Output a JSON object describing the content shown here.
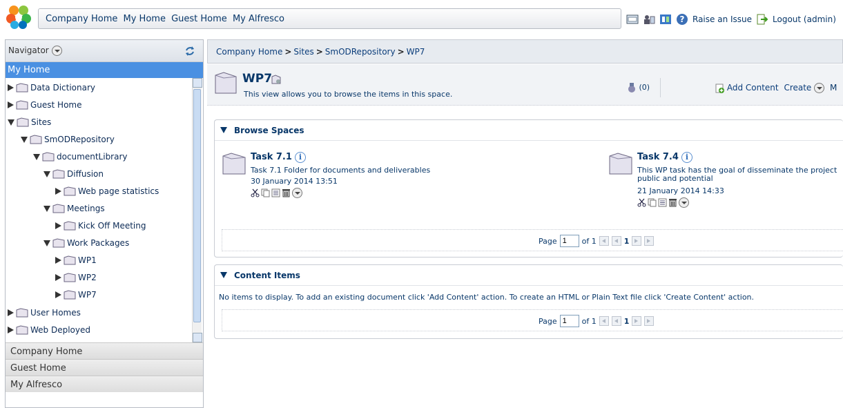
{
  "topnav": {
    "links": [
      "Company Home",
      "My Home",
      "Guest Home",
      "My Alfresco"
    ],
    "raise_issue": "Raise an Issue",
    "logout": "Logout (admin)"
  },
  "sidebar": {
    "navigator_label": "Navigator",
    "selected_section": "My Home",
    "tree": [
      {
        "label": "Data Dictionary",
        "expanded": false
      },
      {
        "label": "Guest Home",
        "expanded": false
      },
      {
        "label": "Sites",
        "expanded": true
      },
      {
        "label": "SmODRepository",
        "expanded": true
      },
      {
        "label": "documentLibrary",
        "expanded": true
      },
      {
        "label": "Diffusion",
        "expanded": true
      },
      {
        "label": "Web page statistics",
        "expanded": false
      },
      {
        "label": "Meetings",
        "expanded": true
      },
      {
        "label": "Kick Off Meeting",
        "expanded": false
      },
      {
        "label": "Work Packages",
        "expanded": true
      },
      {
        "label": "WP1",
        "expanded": false
      },
      {
        "label": "WP2",
        "expanded": false
      },
      {
        "label": "WP7",
        "expanded": false
      },
      {
        "label": "User Homes",
        "expanded": false
      },
      {
        "label": "Web Deployed",
        "expanded": false
      }
    ],
    "accordion": [
      "Company Home",
      "Guest Home",
      "My Alfresco"
    ]
  },
  "breadcrumb": [
    "Company Home",
    "Sites",
    "SmODRepository",
    "WP7"
  ],
  "space": {
    "title": "WP7",
    "description": "This view allows you to browse the items in this space.",
    "rss_count": "(0)",
    "add_content": "Add Content",
    "create": "Create",
    "more": "M"
  },
  "browse_spaces": {
    "title": "Browse Spaces",
    "items": [
      {
        "title": "Task 7.1",
        "desc": "Task 7.1 Folder for documents and deliverables",
        "desc2": "",
        "date": "30 January 2014 13:51"
      },
      {
        "title": "Task 7.4",
        "desc": "This WP task has the goal of disseminate the project",
        "desc2": "public and potential",
        "date": "21 January 2014 14:33"
      }
    ],
    "pager": {
      "label": "Page",
      "value": "1",
      "of": "of 1",
      "current": "1"
    }
  },
  "content_items": {
    "title": "Content Items",
    "empty": "No items to display. To add an existing document click 'Add Content' action. To create an HTML or Plain Text file click 'Create Content' action.",
    "pager": {
      "label": "Page",
      "value": "1",
      "of": "of 1",
      "current": "1"
    }
  },
  "colors": {
    "accent": "#4a90e2",
    "link": "#083769"
  }
}
